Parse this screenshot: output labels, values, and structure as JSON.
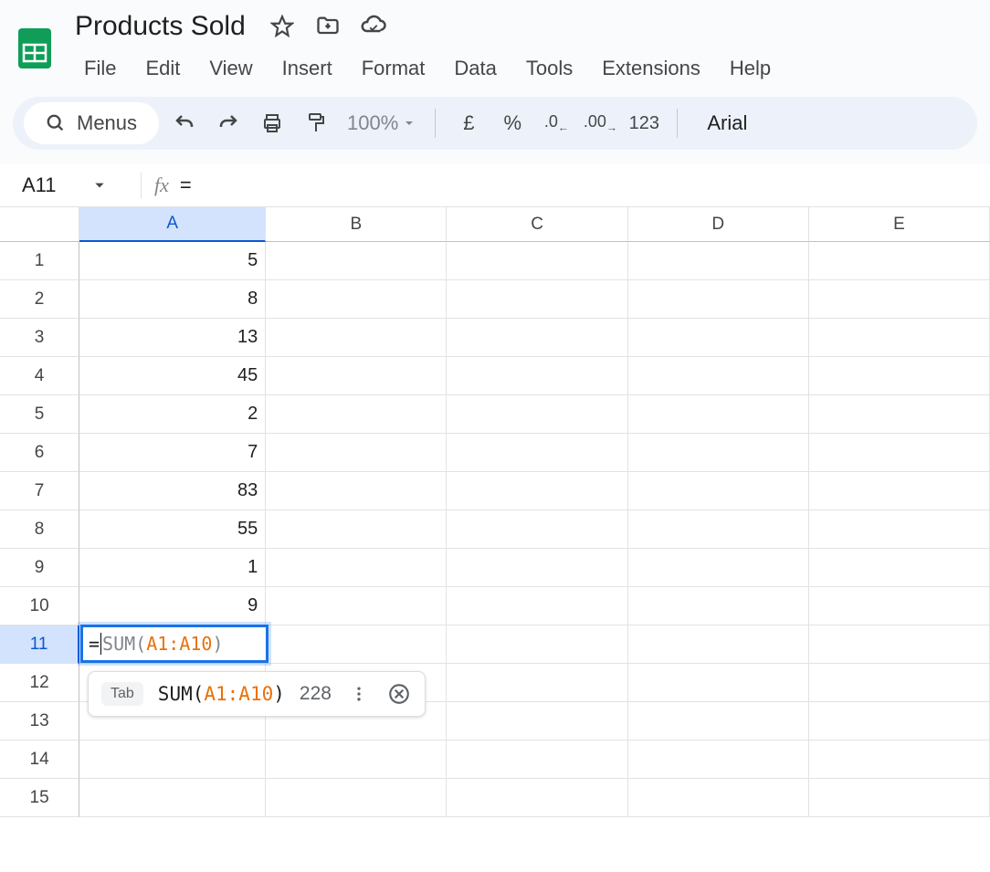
{
  "doc": {
    "title": "Products Sold"
  },
  "menu": [
    "File",
    "Edit",
    "View",
    "Insert",
    "Format",
    "Data",
    "Tools",
    "Extensions",
    "Help"
  ],
  "toolbar": {
    "menus_label": "Menus",
    "zoom": "100%",
    "currency": "£",
    "percent": "%",
    "number_format": "123",
    "font": "Arial"
  },
  "formula_bar": {
    "cell_ref": "A11",
    "value": "="
  },
  "grid": {
    "columns": [
      "A",
      "B",
      "C",
      "D",
      "E"
    ],
    "rows": [
      1,
      2,
      3,
      4,
      5,
      6,
      7,
      8,
      9,
      10,
      11,
      12,
      13,
      14,
      15
    ],
    "selected_cell": "A11",
    "values": {
      "A": [
        5,
        8,
        13,
        45,
        2,
        7,
        83,
        55,
        1,
        9
      ]
    }
  },
  "active_cell": {
    "eq": "=",
    "func": "SUM(",
    "range": "A1:A10",
    "close": ")"
  },
  "suggestion": {
    "hint": "Tab",
    "func": "SUM(",
    "range": "A1:A10",
    "close": ")",
    "result": "228"
  }
}
